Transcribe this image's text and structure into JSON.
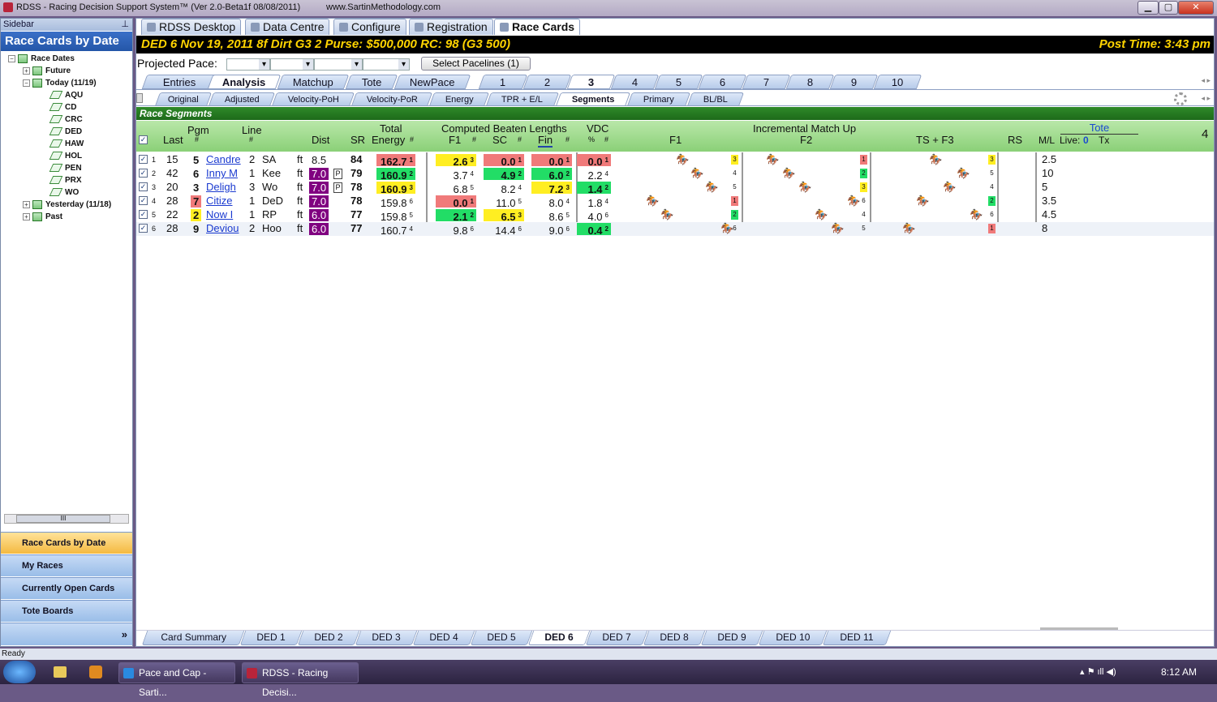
{
  "window": {
    "title": "RDSS - Racing Decision Support System™ (Ver 2.0-Beta1f 08/08/2011)",
    "url": "www.SartinMethodology.com",
    "min": "▁",
    "max": "▢",
    "close": "✕"
  },
  "sidebar": {
    "header": "Sidebar",
    "pin": "⊥",
    "title": "Race Cards by Date",
    "tree": {
      "root": "Race Dates",
      "future": "Future",
      "today": "Today (11/19)",
      "tracks": [
        "AQU",
        "CD",
        "CRC",
        "DED",
        "HAW",
        "HOL",
        "PEN",
        "PRX",
        "WO"
      ],
      "yesterday": "Yesterday (11/18)",
      "past": "Past",
      "expand": "+",
      "collapse": "−"
    },
    "scroll_thumb": "III",
    "nav": [
      "Race Cards by Date",
      "My Races",
      "Currently Open Cards",
      "Tote Boards"
    ],
    "more": "»"
  },
  "toptabs": [
    "RDSS Desktop",
    "Data Centre",
    "Configure",
    "Registration",
    "Race Cards"
  ],
  "race": {
    "left": "DED  6   Nov 19, 2011       8f  Dirt   G3  2   Purse: $500,000   RC: 98  (G3 500)",
    "post": "Post Time: 3:43 pm"
  },
  "pace": {
    "label": "Projected Pace:",
    "button": "Select Pacelines  (1)"
  },
  "tabs": {
    "views": [
      "Entries",
      "Analysis",
      "Matchup",
      "Tote",
      "NewPace"
    ],
    "races": [
      "1",
      "2",
      "3",
      "4",
      "5",
      "6",
      "7",
      "8",
      "9",
      "10"
    ],
    "sub": [
      "Original",
      "Adjusted",
      "Velocity-PoH",
      "Velocity-PoR",
      "Energy",
      "TPR + E/L",
      "Segments",
      "Primary",
      "BL/BL"
    ],
    "arrows": "◂ ▸"
  },
  "segments_title": "Race Segments",
  "header": {
    "pgm": "Pgm",
    "pgm_hash": "#",
    "last": "Last",
    "line": "Line",
    "line_hash": "#",
    "dist": "Dist",
    "sr": "SR",
    "total": "Total",
    "energy": "Energy",
    "energy_hash": "#",
    "cbl": "Computed Beaten Lengths",
    "f1": "F1",
    "sc": "SC",
    "fin": "Fin",
    "hash": "#",
    "vdc": "VDC",
    "pct": "%",
    "imu": "Incremental Match Up",
    "imu_f1": "F1",
    "imu_f2": "F2",
    "ts": "TS + F3",
    "rs": "RS",
    "tote": "Tote",
    "ml": "M/L",
    "live": "Live:",
    "live_val": "0",
    "tx": "Tx",
    "count": "4",
    "check": "✓"
  },
  "rows": [
    {
      "n": "1",
      "last": "15",
      "pgm": "5",
      "name": "Candre",
      "line": "2",
      "trk": "SA",
      "sf": "ft",
      "dist": "8.5",
      "p": "",
      "sr": "84",
      "en": "162.7",
      "enr": "1",
      "f1": "2.6",
      "f1r": "3",
      "sc": "0.0",
      "scr": "1",
      "fin": "0.0",
      "finr": "1",
      "vdc": "0.0",
      "vdcr": "1",
      "b1": "3",
      "b2": "1",
      "b3": "3",
      "ml": "2.5"
    },
    {
      "n": "2",
      "last": "42",
      "pgm": "6",
      "name": "Inny M",
      "line": "1",
      "trk": "Kee",
      "sf": "ft",
      "dist": "7.0",
      "p": "P",
      "sr": "79",
      "en": "160.9",
      "enr": "2",
      "f1": "3.7",
      "f1r": "4",
      "sc": "4.9",
      "scr": "2",
      "fin": "6.0",
      "finr": "2",
      "vdc": "2.2",
      "vdcr": "4",
      "b1": "4",
      "b2": "2",
      "b3": "5",
      "ml": "10"
    },
    {
      "n": "3",
      "last": "20",
      "pgm": "3",
      "name": "Deligh",
      "line": "3",
      "trk": "Wo",
      "sf": "ft",
      "dist": "7.0",
      "p": "P",
      "sr": "78",
      "en": "160.9",
      "enr": "3",
      "f1": "6.8",
      "f1r": "5",
      "sc": "8.2",
      "scr": "4",
      "fin": "7.2",
      "finr": "3",
      "vdc": "1.4",
      "vdcr": "2",
      "b1": "5",
      "b2": "3",
      "b3": "4",
      "ml": "5"
    },
    {
      "n": "4",
      "last": "28",
      "pgm": "7",
      "name": "Citize",
      "line": "1",
      "trk": "DeD",
      "sf": "ft",
      "dist": "7.0",
      "p": "",
      "sr": "78",
      "en": "159.8",
      "enr": "6",
      "f1": "0.0",
      "f1r": "1",
      "sc": "11.0",
      "scr": "5",
      "fin": "8.0",
      "finr": "4",
      "vdc": "1.8",
      "vdcr": "4",
      "b1": "1",
      "b2": "6",
      "b3": "2",
      "ml": "3.5"
    },
    {
      "n": "5",
      "last": "22",
      "pgm": "2",
      "name": "Now I",
      "line": "1",
      "trk": "RP",
      "sf": "ft",
      "dist": "6.0",
      "p": "",
      "sr": "77",
      "en": "159.8",
      "enr": "5",
      "f1": "2.1",
      "f1r": "2",
      "sc": "6.5",
      "scr": "3",
      "fin": "8.6",
      "finr": "5",
      "vdc": "4.0",
      "vdcr": "6",
      "b1": "2",
      "b2": "4",
      "b3": "6",
      "ml": "4.5"
    },
    {
      "n": "6",
      "last": "28",
      "pgm": "9",
      "name": "Deviou",
      "line": "2",
      "trk": "Hoo",
      "sf": "ft",
      "dist": "6.0",
      "p": "",
      "sr": "77",
      "en": "160.7",
      "enr": "4",
      "f1": "9.8",
      "f1r": "6",
      "sc": "14.4",
      "scr": "6",
      "fin": "9.0",
      "finr": "6",
      "vdc": "0.4",
      "vdcr": "2",
      "b1": "6",
      "b2": "5",
      "b3": "1",
      "ml": "8"
    }
  ],
  "bottom_tabs": [
    "Card Summary",
    "DED 1",
    "DED 2",
    "DED 3",
    "DED 4",
    "DED 5",
    "DED 6",
    "DED 7",
    "DED 8",
    "DED 9",
    "DED 10",
    "DED 11"
  ],
  "status": "Ready",
  "taskbar": {
    "items": [
      "Pace and Cap - Sarti...",
      "RDSS - Racing Decisi..."
    ],
    "time": "8:12 AM",
    "tray": "▴  ⚑  ıll  ◀)"
  },
  "colors": {
    "red": "#f07a7a",
    "yellow": "#ffee22",
    "green": "#22dd66",
    "purple": "#800080"
  }
}
